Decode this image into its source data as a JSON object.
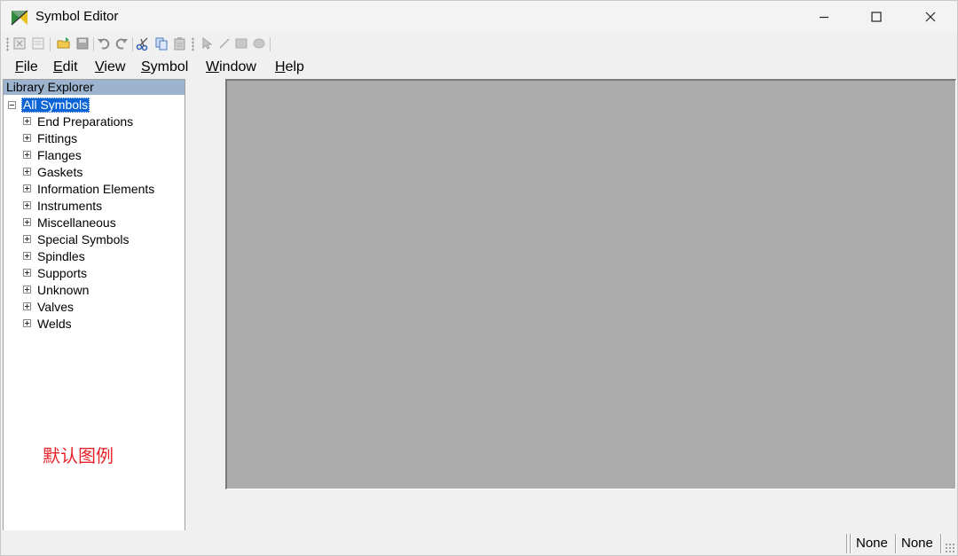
{
  "window": {
    "title": "Symbol Editor",
    "icon": "symbol-editor-app-icon"
  },
  "toolbar": {
    "icons": [
      "new-icon",
      "new-symbol-icon",
      "open-icon",
      "save-icon",
      "undo-icon",
      "redo-icon",
      "cut-icon",
      "copy-icon",
      "paste-icon",
      "pointer-icon",
      "line-icon",
      "rectangle-icon",
      "ellipse-icon"
    ]
  },
  "menu": {
    "file": {
      "ul": "F",
      "rest": "ile"
    },
    "edit": {
      "ul": "E",
      "rest": "dit"
    },
    "view": {
      "ul": "V",
      "rest": "iew"
    },
    "symbol": {
      "ul": "S",
      "rest": "ymbol"
    },
    "window": {
      "ul": "W",
      "rest": "indow"
    },
    "help": {
      "ul": "H",
      "rest": "elp"
    }
  },
  "explorer": {
    "header": "Library Explorer",
    "root": "All Symbols",
    "items": [
      "End Preparations",
      "Fittings",
      "Flanges",
      "Gaskets",
      "Information Elements",
      "Instruments",
      "Miscellaneous",
      "Special Symbols",
      "Spindles",
      "Supports",
      "Unknown",
      "Valves",
      "Welds"
    ],
    "annotation": "默认图例"
  },
  "status": {
    "cell1": "None",
    "cell2": "None"
  },
  "colors": {
    "selection": "#0a64d6",
    "explorer_header": "#9db4cf",
    "canvas": "#ababab",
    "annotation": "#e8222a"
  }
}
